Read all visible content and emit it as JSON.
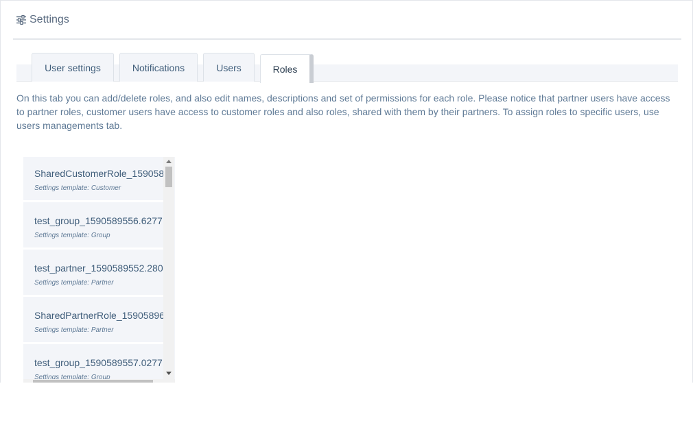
{
  "header": {
    "title": "Settings",
    "icon": "sliders-icon"
  },
  "tabs": [
    {
      "label": "User settings",
      "active": false
    },
    {
      "label": "Notifications",
      "active": false
    },
    {
      "label": "Users",
      "active": false
    },
    {
      "label": "Roles",
      "active": true
    }
  ],
  "description": "On this tab you can add/delete roles, and also edit names, descriptions and set of permissions for each role. Please notice that partner users have access to partner roles, customer users have access to customer roles and also roles, shared with them by their partners. To assign roles to specific users, use users managements tab.",
  "roles": [
    {
      "name": "SharedCustomerRole_159058",
      "template": "Settings template: Customer"
    },
    {
      "name": "test_group_1590589556.6277",
      "template": "Settings template: Group"
    },
    {
      "name": "test_partner_1590589552.280",
      "template": "Settings template: Partner"
    },
    {
      "name": "SharedPartnerRole_15905896",
      "template": "Settings template: Partner"
    },
    {
      "name": "test_group_1590589557.0277",
      "template": "Settings template: Group"
    }
  ]
}
